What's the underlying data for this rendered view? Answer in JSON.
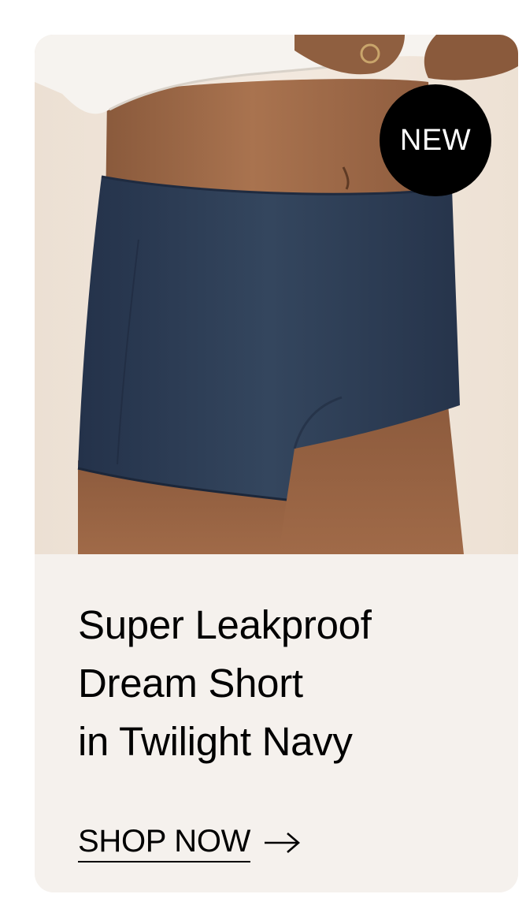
{
  "product_card": {
    "badge": "NEW",
    "title_lines": [
      "Super Leakproof",
      "Dream Short",
      "in Twilight Navy"
    ],
    "cta_label": "SHOP NOW",
    "cta_icon": "arrow-right-icon",
    "image_subject": "model wearing navy shorts",
    "colors": {
      "navy": "#2d3d52",
      "card_background": "#f5f1ed",
      "badge_background": "#000000",
      "badge_text": "#ffffff",
      "text": "#000000"
    }
  }
}
